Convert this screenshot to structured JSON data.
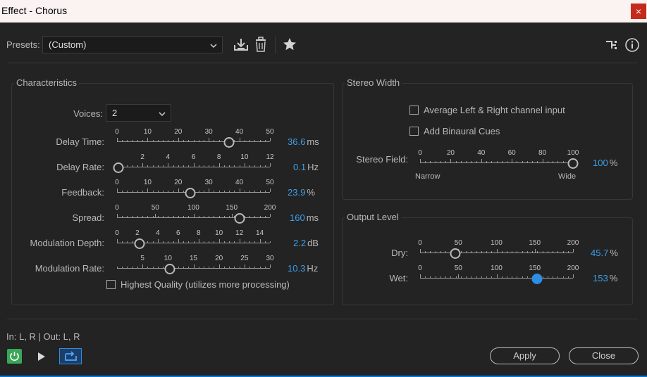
{
  "window": {
    "title": "Effect - Chorus",
    "close_glyph": "×"
  },
  "presets": {
    "label": "Presets:",
    "value": "(Custom)",
    "icons": [
      "download-icon",
      "trash-icon",
      "star-icon"
    ]
  },
  "toolbar_right": {
    "icons": [
      "routing-icon",
      "info-icon"
    ]
  },
  "characteristics": {
    "title": "Characteristics",
    "voices_label": "Voices:",
    "voices_value": "2",
    "sliders": [
      {
        "label": "Delay Time:",
        "ticks": [
          "0",
          "10",
          "20",
          "30",
          "40",
          "50"
        ],
        "min": 0,
        "max": 50,
        "value": 36.6,
        "display": "36.6",
        "unit": "ms"
      },
      {
        "label": "Delay Rate:",
        "ticks": [
          "2",
          "4",
          "6",
          "8",
          "10",
          "12"
        ],
        "min": 0,
        "max": 12,
        "value": 0.1,
        "display": "0.1",
        "unit": "Hz"
      },
      {
        "label": "Feedback:",
        "ticks": [
          "0",
          "10",
          "20",
          "30",
          "40",
          "50"
        ],
        "min": 0,
        "max": 50,
        "value": 23.9,
        "display": "23.9",
        "unit": "%"
      },
      {
        "label": "Spread:",
        "ticks": [
          "0",
          "50",
          "100",
          "150",
          "200"
        ],
        "min": 0,
        "max": 200,
        "value": 160,
        "display": "160",
        "unit": "ms"
      },
      {
        "label": "Modulation Depth:",
        "ticks": [
          "0",
          "2",
          "4",
          "6",
          "8",
          "10",
          "12",
          "14"
        ],
        "min": 0,
        "max": 15,
        "value": 2.2,
        "display": "2.2",
        "unit": "dB"
      },
      {
        "label": "Modulation Rate:",
        "ticks": [
          "5",
          "10",
          "15",
          "20",
          "25",
          "30"
        ],
        "min": 0,
        "max": 30,
        "value": 10.3,
        "display": "10.3",
        "unit": "Hz"
      }
    ],
    "hq_label": "Highest Quality (utilizes more processing)",
    "hq_checked": false
  },
  "stereo_width": {
    "title": "Stereo Width",
    "avg_label": "Average Left & Right channel input",
    "avg_checked": false,
    "binaural_label": "Add Binaural Cues",
    "binaural_checked": false,
    "field": {
      "label": "Stereo Field:",
      "ticks": [
        "0",
        "20",
        "40",
        "60",
        "80",
        "100"
      ],
      "min": 0,
      "max": 100,
      "value": 100,
      "display": "100",
      "unit": "%",
      "left_caption": "Narrow",
      "right_caption": "Wide"
    }
  },
  "output_level": {
    "title": "Output Level",
    "sliders": [
      {
        "label": "Dry:",
        "ticks": [
          "0",
          "50",
          "100",
          "150",
          "200"
        ],
        "min": 0,
        "max": 200,
        "value": 45.7,
        "display": "45.7",
        "unit": "%",
        "active": false
      },
      {
        "label": "Wet:",
        "ticks": [
          "0",
          "50",
          "100",
          "150",
          "200"
        ],
        "min": 0,
        "max": 200,
        "value": 153,
        "display": "153",
        "unit": "%",
        "active": true
      }
    ]
  },
  "footer": {
    "io_text": "In: L, R | Out: L, R",
    "apply_label": "Apply",
    "close_label": "Close",
    "icons": [
      "power-icon",
      "play-icon",
      "loop-icon"
    ],
    "colors": {
      "power": "#3aa657",
      "accent": "#2e8de4"
    }
  }
}
